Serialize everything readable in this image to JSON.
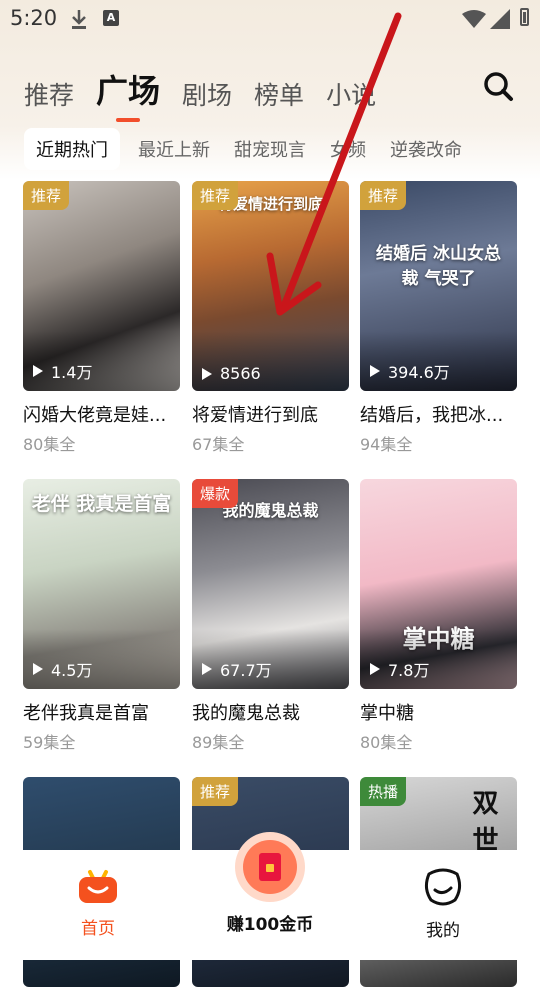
{
  "status": {
    "time": "5:20",
    "a_icon": "A"
  },
  "tabs": [
    {
      "label": "推荐"
    },
    {
      "label": "广场"
    },
    {
      "label": "剧场"
    },
    {
      "label": "榜单"
    },
    {
      "label": "小说"
    }
  ],
  "chips": [
    {
      "label": "近期热门"
    },
    {
      "label": "最近上新"
    },
    {
      "label": "甜宠现言"
    },
    {
      "label": "女频"
    },
    {
      "label": "逆袭改命"
    }
  ],
  "dramas": [
    {
      "title": "闪婚大佬竟是娃...",
      "episodes": "80集全",
      "views": "1.4万",
      "badge": "推荐",
      "badge_color": "#d1a23c"
    },
    {
      "title": "将爱情进行到底",
      "episodes": "67集全",
      "views": "8566",
      "badge": "推荐",
      "badge_color": "#d1a23c",
      "cover_text": "将爱情进行到底"
    },
    {
      "title": "结婚后，我把冰...",
      "episodes": "94集全",
      "views": "394.6万",
      "badge": "推荐",
      "badge_color": "#d1a23c",
      "cover_text": "结婚后 冰山女总裁 气哭了"
    },
    {
      "title": "老伴我真是首富",
      "episodes": "59集全",
      "views": "4.5万",
      "cover_text": "老伴 我真是首富"
    },
    {
      "title": "我的魔鬼总裁",
      "episodes": "89集全",
      "views": "67.7万",
      "badge": "爆款",
      "badge_color": "#e84b3a",
      "cover_text": "我的魔鬼总裁"
    },
    {
      "title": "掌中糖",
      "episodes": "80集全",
      "views": "7.8万",
      "cover_text": "掌中糖"
    },
    {
      "badge_color": "#333"
    },
    {
      "badge": "推荐",
      "badge_color": "#d1a23c"
    },
    {
      "badge": "热播",
      "badge_color": "#3e8a3a",
      "cover_text": "双世"
    }
  ],
  "bottom_nav": {
    "home": "首页",
    "earn": "赚100金币",
    "mine": "我的"
  },
  "colors": {
    "accent": "#f24e2b",
    "home_active": "#f4511e"
  }
}
